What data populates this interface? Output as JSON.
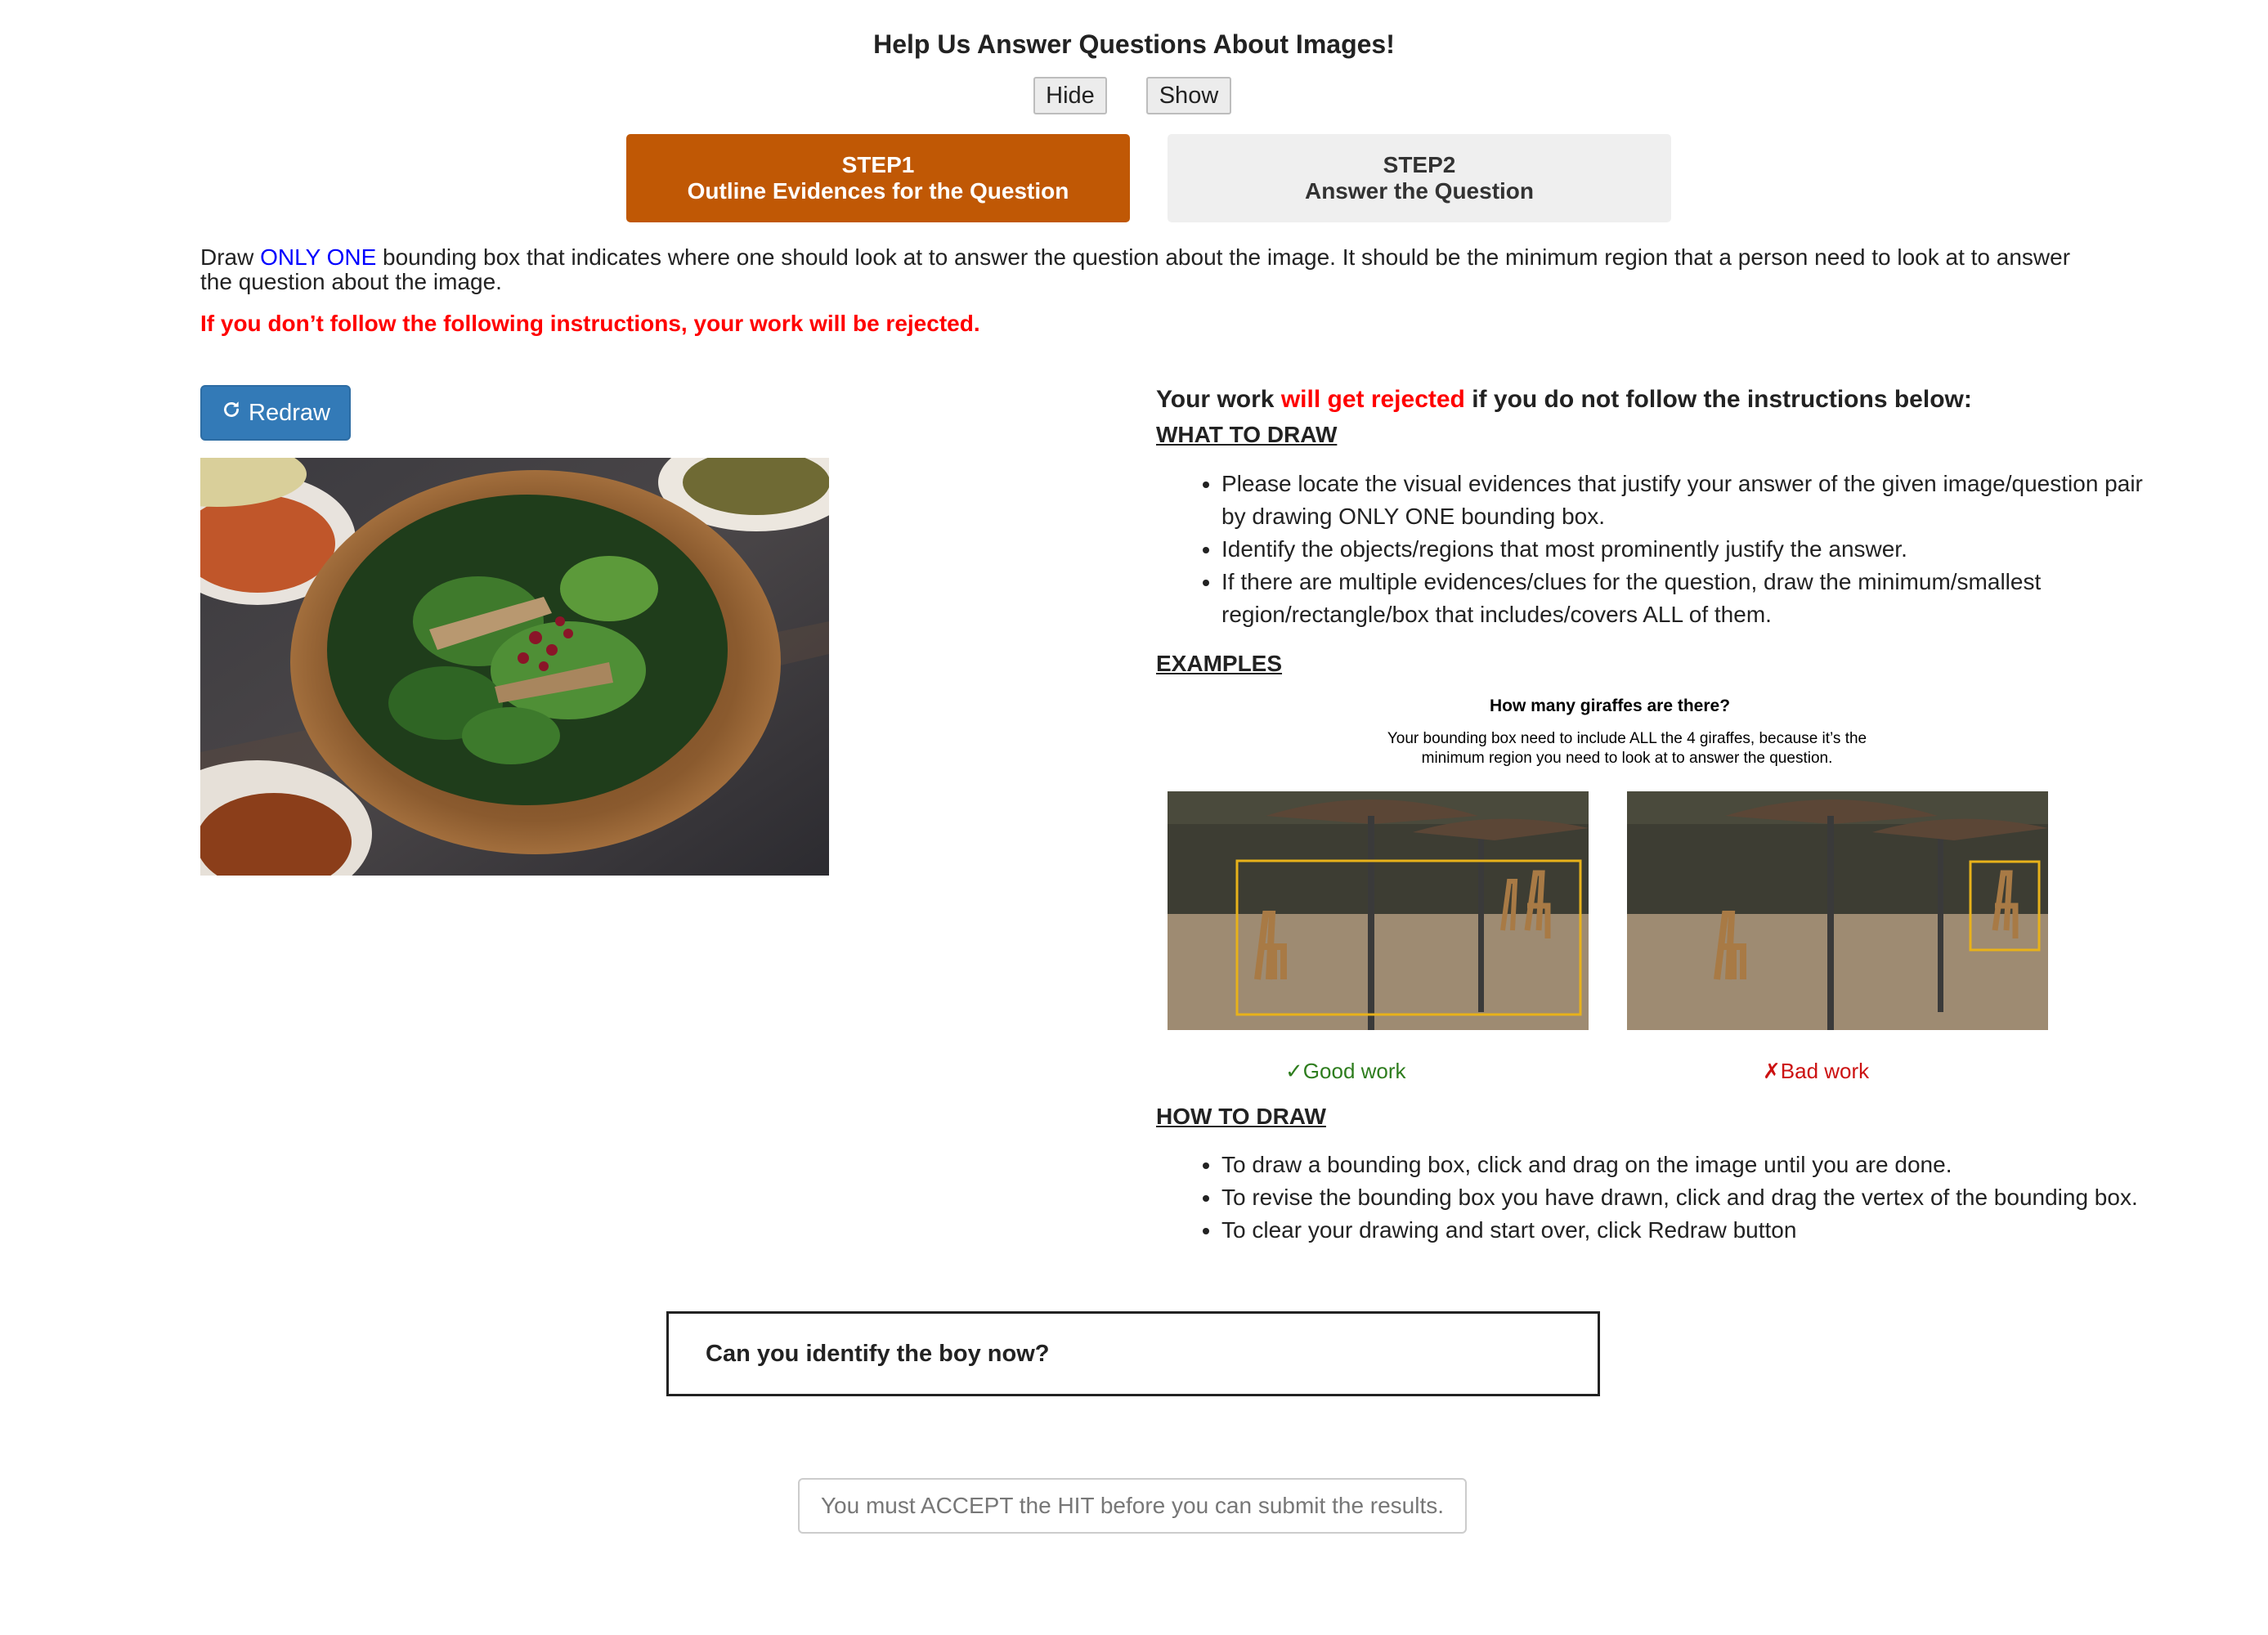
{
  "header": {
    "title": "Help Us Answer Questions About Images!",
    "hide_label": "Hide",
    "show_label": "Show"
  },
  "steps": [
    {
      "line1": "STEP1",
      "line2": "Outline Evidences for the Question"
    },
    {
      "line1": "STEP2",
      "line2": "Answer the Question"
    }
  ],
  "instructions": {
    "intro_before": "Draw ",
    "intro_highlight": "ONLY ONE",
    "intro_after": " bounding box that indicates where one should look at to answer the question about the image. It should be the minimum region that a person need to look at to answer the question about the image.",
    "warning": "If you don’t follow the following instructions, your work will be rejected."
  },
  "redraw_button": {
    "label": "Redraw",
    "icon": "redo-icon"
  },
  "right_panel": {
    "heading_before": "Your work ",
    "heading_highlight": "will get rejected",
    "heading_after": " if you do not follow the instructions below:",
    "what_to_draw": {
      "title": "WHAT TO DRAW",
      "items": [
        "Please locate the visual evidences that justify your answer of the given image/question pair by drawing ONLY ONE bounding box.",
        "Identify the objects/regions that most prominently justify the answer.",
        "If there are multiple evidences/clues for the question, draw the minimum/smallest region/rectangle/box that includes/covers ALL of them."
      ]
    },
    "examples": {
      "title": "EXAMPLES",
      "question": "How many giraffes are there?",
      "note": "Your bounding box need to include ALL the 4 giraffes, because it’s the minimum region you need to look at to answer the question.",
      "good_mark": "✓",
      "good_label": "Good work",
      "bad_mark": "✗",
      "bad_label": "Bad work"
    },
    "how_to_draw": {
      "title": "HOW TO DRAW",
      "items": [
        "To draw a bounding box, click and drag on the image until you are done.",
        "To revise the bounding box you have drawn, click and drag the vertex of the bounding box.",
        "To clear your drawing and start over, click Redraw button"
      ]
    }
  },
  "question": {
    "text": "Can you identify the boy now?"
  },
  "submit": {
    "label": "You must ACCEPT the HIT before you can submit the results."
  },
  "colors": {
    "step_active": "#c05805",
    "redraw": "#337ab7",
    "warning": "#ff0000",
    "highlight": "#0000ff",
    "good": "#2e7d1e",
    "bad": "#cc1111",
    "box": "#e8b21a"
  }
}
